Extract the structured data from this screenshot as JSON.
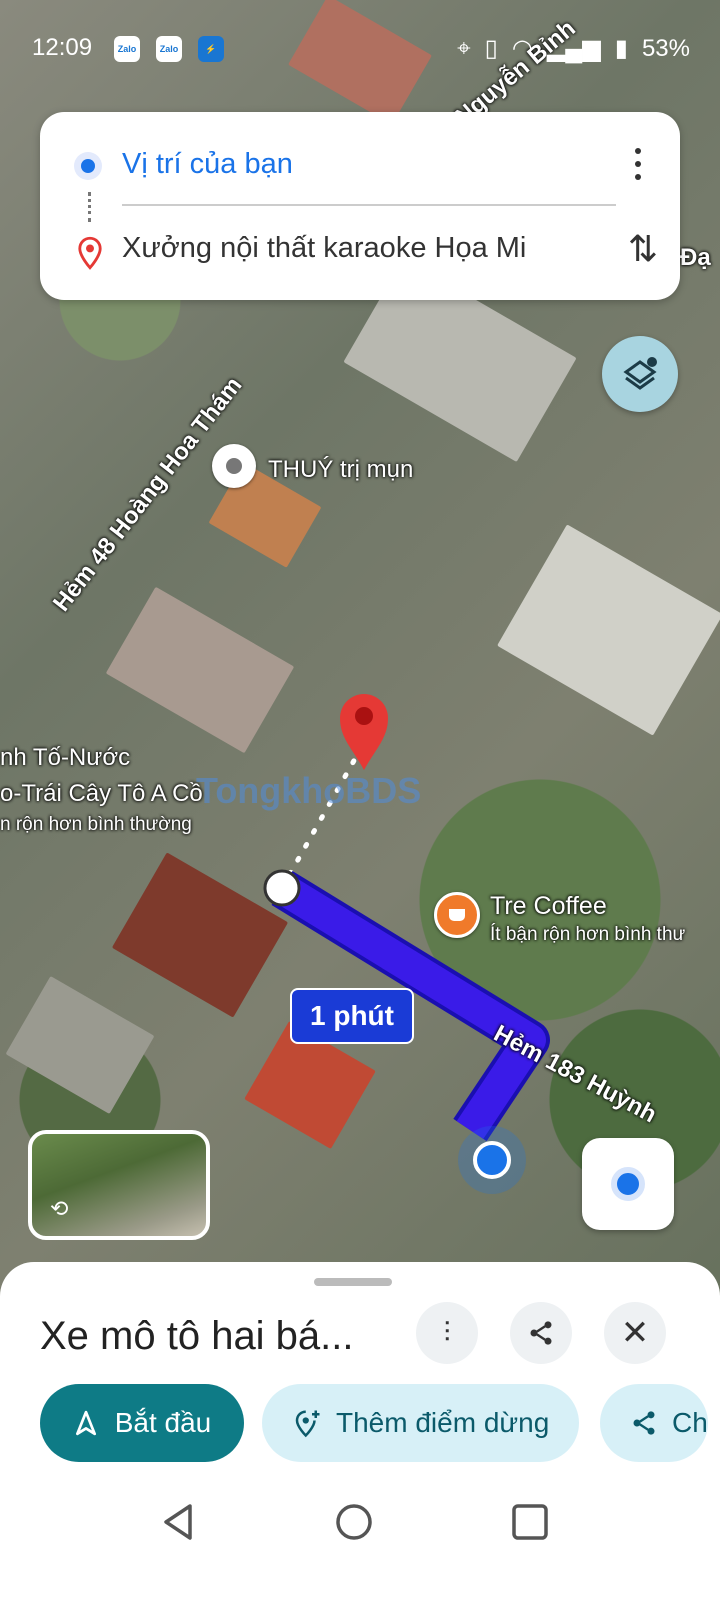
{
  "status_bar": {
    "time": "12:09",
    "notif_1": "Zalo",
    "notif_2": "Zalo",
    "battery": "53%"
  },
  "directions": {
    "origin": "Vị trí của bạn",
    "destination": "Xưởng nội thất karaoke Họa Mi"
  },
  "map": {
    "street_1": "Hẻm 48 Hoàng Hoa Thám",
    "street_2": "Hẻm 183 Huỳnh",
    "street_3": "Nguyễn Bỉnh",
    "street_4": "Đạ",
    "poi_thuy": "THUÝ trị mụn",
    "poi_left_1": "nh Tố-Nước",
    "poi_left_2": "o-Trái Cây Tô A Cồ",
    "poi_left_3": "n rộn hơn bình thường",
    "poi_coffee": "Tre Coffee",
    "poi_coffee_status": "Ít bận rộn hơn bình thư",
    "watermark": "TongkhoBDS",
    "route_duration": "1 phút"
  },
  "bottom_sheet": {
    "title": "Xe mô tô hai bá...",
    "start_label": "Bắt đầu",
    "add_stop_label": "Thêm điểm dừng",
    "share_label": "Ch"
  },
  "colors": {
    "route": "#3a1be8",
    "accent": "#1a73e8",
    "start_button": "#0e7b86",
    "pin": "#e53935"
  }
}
